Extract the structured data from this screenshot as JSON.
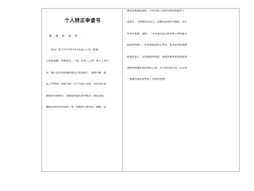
{
  "document": {
    "title": "个人转正申请书",
    "salutation": "敬 爱 的 领 导 ：",
    "left_lines": [
      "您好！我于2012年1月1日进入公司，根据",
      "公司的需要，目前担任__一职，负责__工作。本人工作认",
      "真、细心且具有较强的责任心和进取心，勤勉不懈，极",
      "富工作热情；性格开朗，乐于与他人沟通，具有良好和",
      "熟练的沟通技巧，有很强的团队协作能力；责任感强，",
      "确保完成领导交给的工作，积极学习新知识、技能，注"
    ],
    "right_lines": [
      "重自身发展和进步。平时利用下班时间通过网络学习",
      "业知识，不断地充实自己，以期将来能学以致用，同公",
      "司共同发展、进步。（可以填写自己的具体工作内容与",
      "取得的成绩）。在此我提出转正申请，恳请领导给我继",
      "续锻炼自己、实现理想的机会。我会用谦虚的态度和饱",
      "满的热情做好我的本职工作，为公司创造价值，同公司",
      "一起展望美好的未来！望领导批准！"
    ]
  }
}
